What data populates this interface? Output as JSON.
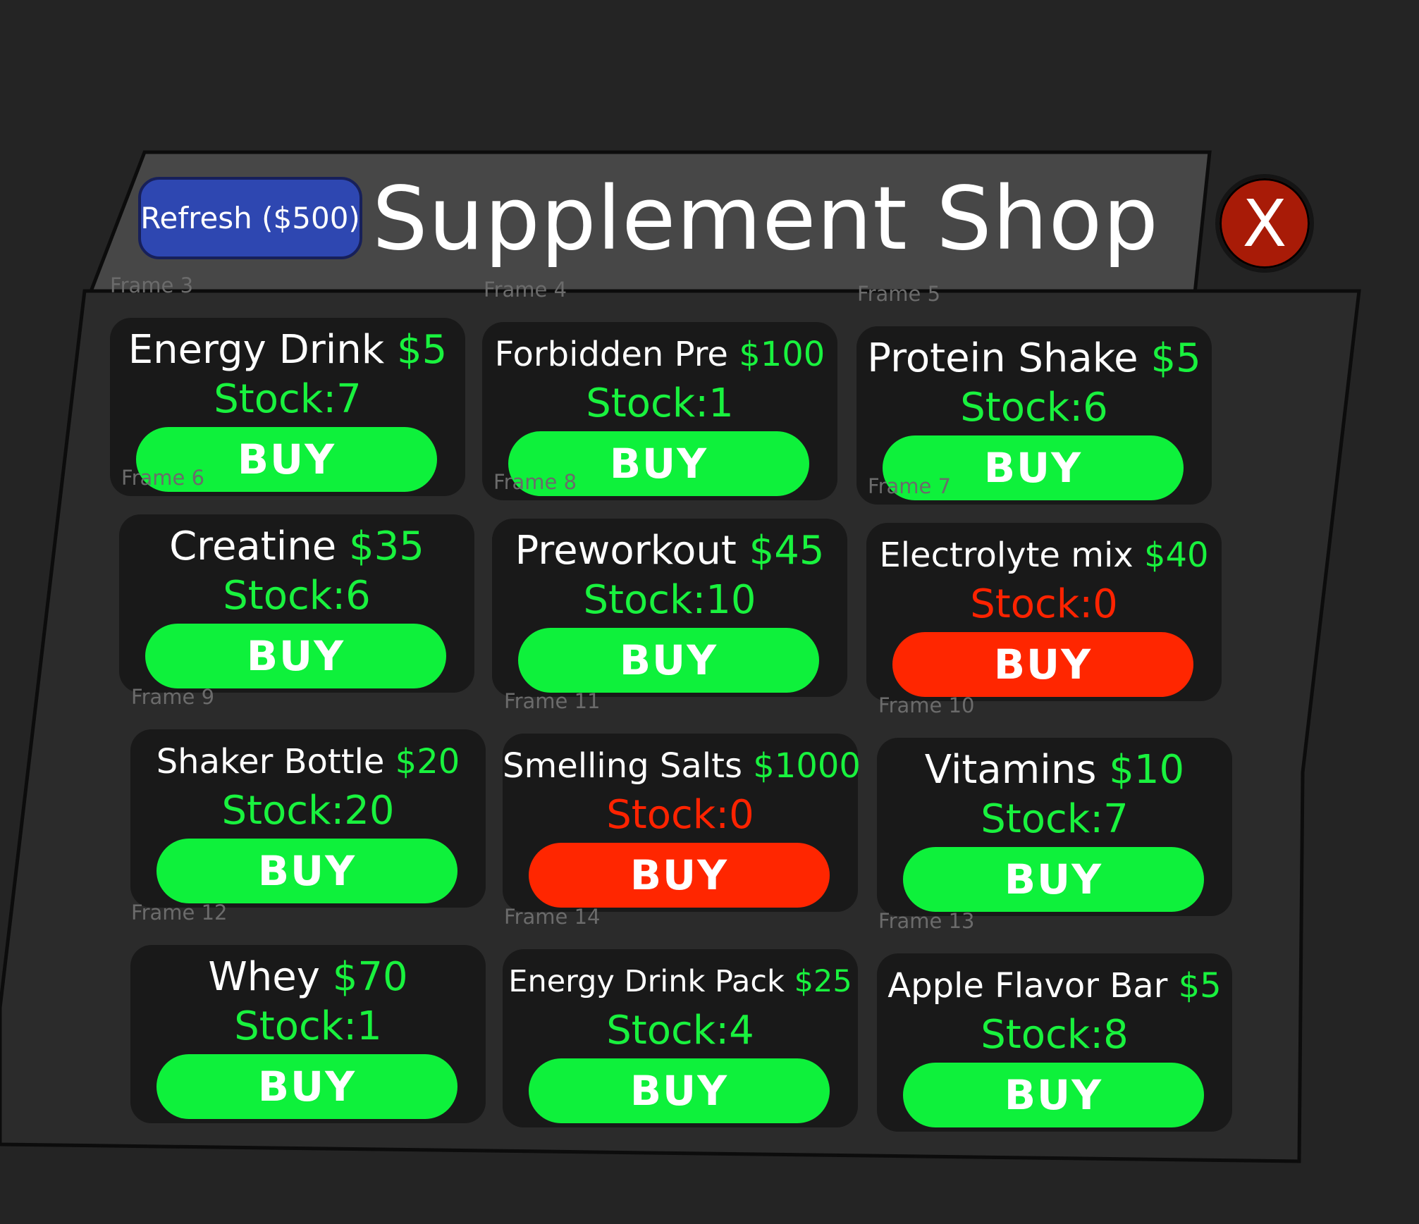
{
  "shop": {
    "title": "Supplement Shop",
    "refresh_label": "Refresh ($500)",
    "close_label": "X"
  },
  "frame_labels": {
    "frame3": "Frame 3",
    "frame4": "Frame 4",
    "frame5": "Frame 5",
    "frame6": "Frame 6",
    "frame7": "Frame 7",
    "frame8": "Frame 8",
    "frame9": "Frame 9",
    "frame10": "Frame 10",
    "frame11": "Frame 11",
    "frame12": "Frame 12",
    "frame13": "Frame 13",
    "frame14": "Frame 14"
  },
  "items": [
    {
      "name": "Energy Drink",
      "price": "$5",
      "stock": "Stock:7",
      "buy": "BUY",
      "in_stock": true
    },
    {
      "name": "Forbidden Pre",
      "price": "$100",
      "stock": "Stock:1",
      "buy": "BUY",
      "in_stock": true
    },
    {
      "name": "Protein Shake",
      "price": "$5",
      "stock": "Stock:6",
      "buy": "BUY",
      "in_stock": true
    },
    {
      "name": "Creatine",
      "price": "$35",
      "stock": "Stock:6",
      "buy": "BUY",
      "in_stock": true
    },
    {
      "name": "Preworkout",
      "price": "$45",
      "stock": "Stock:10",
      "buy": "BUY",
      "in_stock": true
    },
    {
      "name": "Electrolyte mix",
      "price": "$40",
      "stock": "Stock:0",
      "buy": "BUY",
      "in_stock": false
    },
    {
      "name": "Shaker Bottle",
      "price": "$20",
      "stock": "Stock:20",
      "buy": "BUY",
      "in_stock": true
    },
    {
      "name": "Smelling Salts",
      "price": "$1000",
      "stock": "Stock:0",
      "buy": "BUY",
      "in_stock": false
    },
    {
      "name": "Vitamins",
      "price": "$10",
      "stock": "Stock:7",
      "buy": "BUY",
      "in_stock": true
    },
    {
      "name": "Whey",
      "price": "$70",
      "stock": "Stock:1",
      "buy": "BUY",
      "in_stock": true
    },
    {
      "name": "Energy Drink Pack",
      "price": "$25",
      "stock": "Stock:4",
      "buy": "BUY",
      "in_stock": true
    },
    {
      "name": "Apple Flavor Bar",
      "price": "$5",
      "stock": "Stock:8",
      "buy": "BUY",
      "in_stock": true
    }
  ],
  "colors": {
    "background": "#242424",
    "panel": "#2b2b2b",
    "header_panel": "#474747",
    "card": "#191919",
    "price_green": "#19f23e",
    "out_of_stock_red": "#ff2300",
    "buy_green": "#0ef13b",
    "buy_red": "#ff2600",
    "refresh_blue": "#2e47b1",
    "close_red": "#a81b07"
  }
}
